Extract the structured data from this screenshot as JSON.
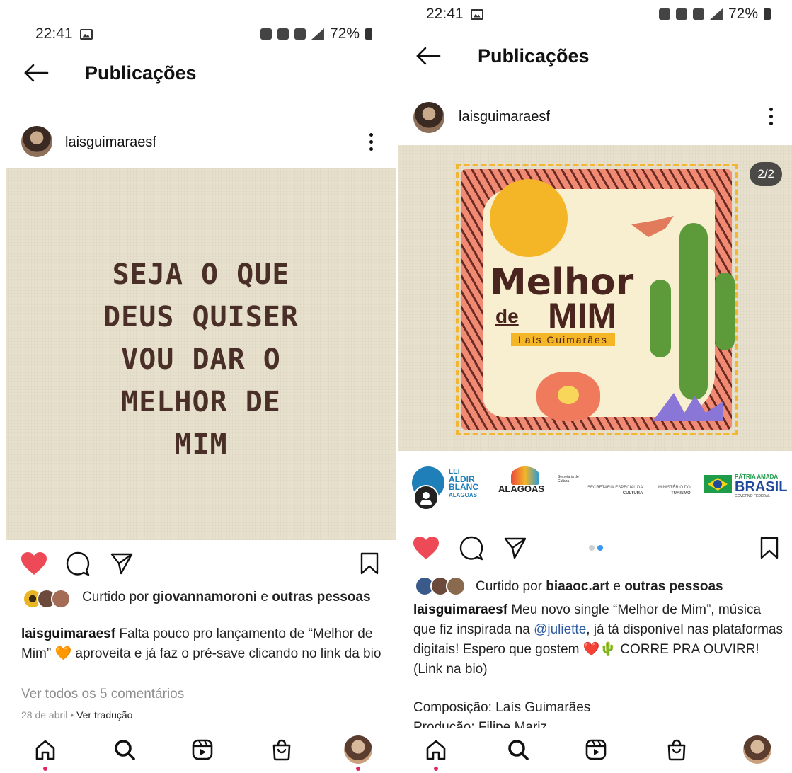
{
  "colors": {
    "like_red": "#ed4956",
    "link_blue": "#2c5aa0",
    "muted_gray": "#8e8e8e",
    "quote_brown": "#4a2f28"
  },
  "left": {
    "status": {
      "time": "22:41",
      "battery": "72%"
    },
    "header": {
      "title": "Publicações"
    },
    "post": {
      "username": "laisguimaraesf",
      "quote_lines": [
        "SEJA O QUE",
        "DEUS QUISER",
        "VOU DAR O",
        "MELHOR DE",
        "MIM"
      ],
      "liked_prefix": "Curtido por",
      "liked_user": "giovannamoroni",
      "liked_conj": "e",
      "liked_others": "outras pessoas",
      "caption_user": "laisguimaraesf",
      "caption_text": "Falta pouco pro lançamento de “Melhor de Mim” 🧡 aproveita e já faz o pré-save clicando no link da bio",
      "view_comments": "Ver todos os 5 comentários",
      "date": "28 de abril",
      "date_sep": "•",
      "translate": "Ver tradução"
    }
  },
  "right": {
    "status": {
      "time": "22:41",
      "battery": "72%"
    },
    "header": {
      "title": "Publicações"
    },
    "post": {
      "username": "laisguimaraesf",
      "carousel_badge": "2/2",
      "art_title_1": "Melhor",
      "art_title_de": "de",
      "art_title_2": "MIM",
      "art_artist": "Laís Guimarães",
      "sponsor_lei": "LEI",
      "sponsor_aldir": "ALDIR",
      "sponsor_blanc": "BLANC",
      "sponsor_alagoas_small": "ALAGOAS",
      "sponsor_alagoas": "ALAGOAS",
      "sponsor_secult": "Secretaria de Cultura",
      "sponsor_cultura_1": "SECRETARIA ESPECIAL DA",
      "sponsor_cultura_2": "CULTURA",
      "sponsor_turismo_1": "MINISTÉRIO DO",
      "sponsor_turismo_2": "TURISMO",
      "sponsor_patria": "PÁTRIA AMADA",
      "sponsor_brasil": "BRASIL",
      "sponsor_governo": "GOVERNO FEDERAL",
      "liked_prefix": "Curtido por",
      "liked_user": "biaaoc.art",
      "liked_conj": "e",
      "liked_others": "outras pessoas",
      "caption_user": "laisguimaraesf",
      "caption_pre": "Meu novo single “Melhor de Mim”, música que fiz inspirada na",
      "caption_mention": "@juliette",
      "caption_post": ", já tá disponível nas plataformas digitais! Espero que gostem ❤️🌵 CORRE PRA OUVIRR! (Link na bio)",
      "credit_1": "Composição: Laís Guimarães",
      "credit_2": "Produção: Filipe Mariz"
    }
  }
}
